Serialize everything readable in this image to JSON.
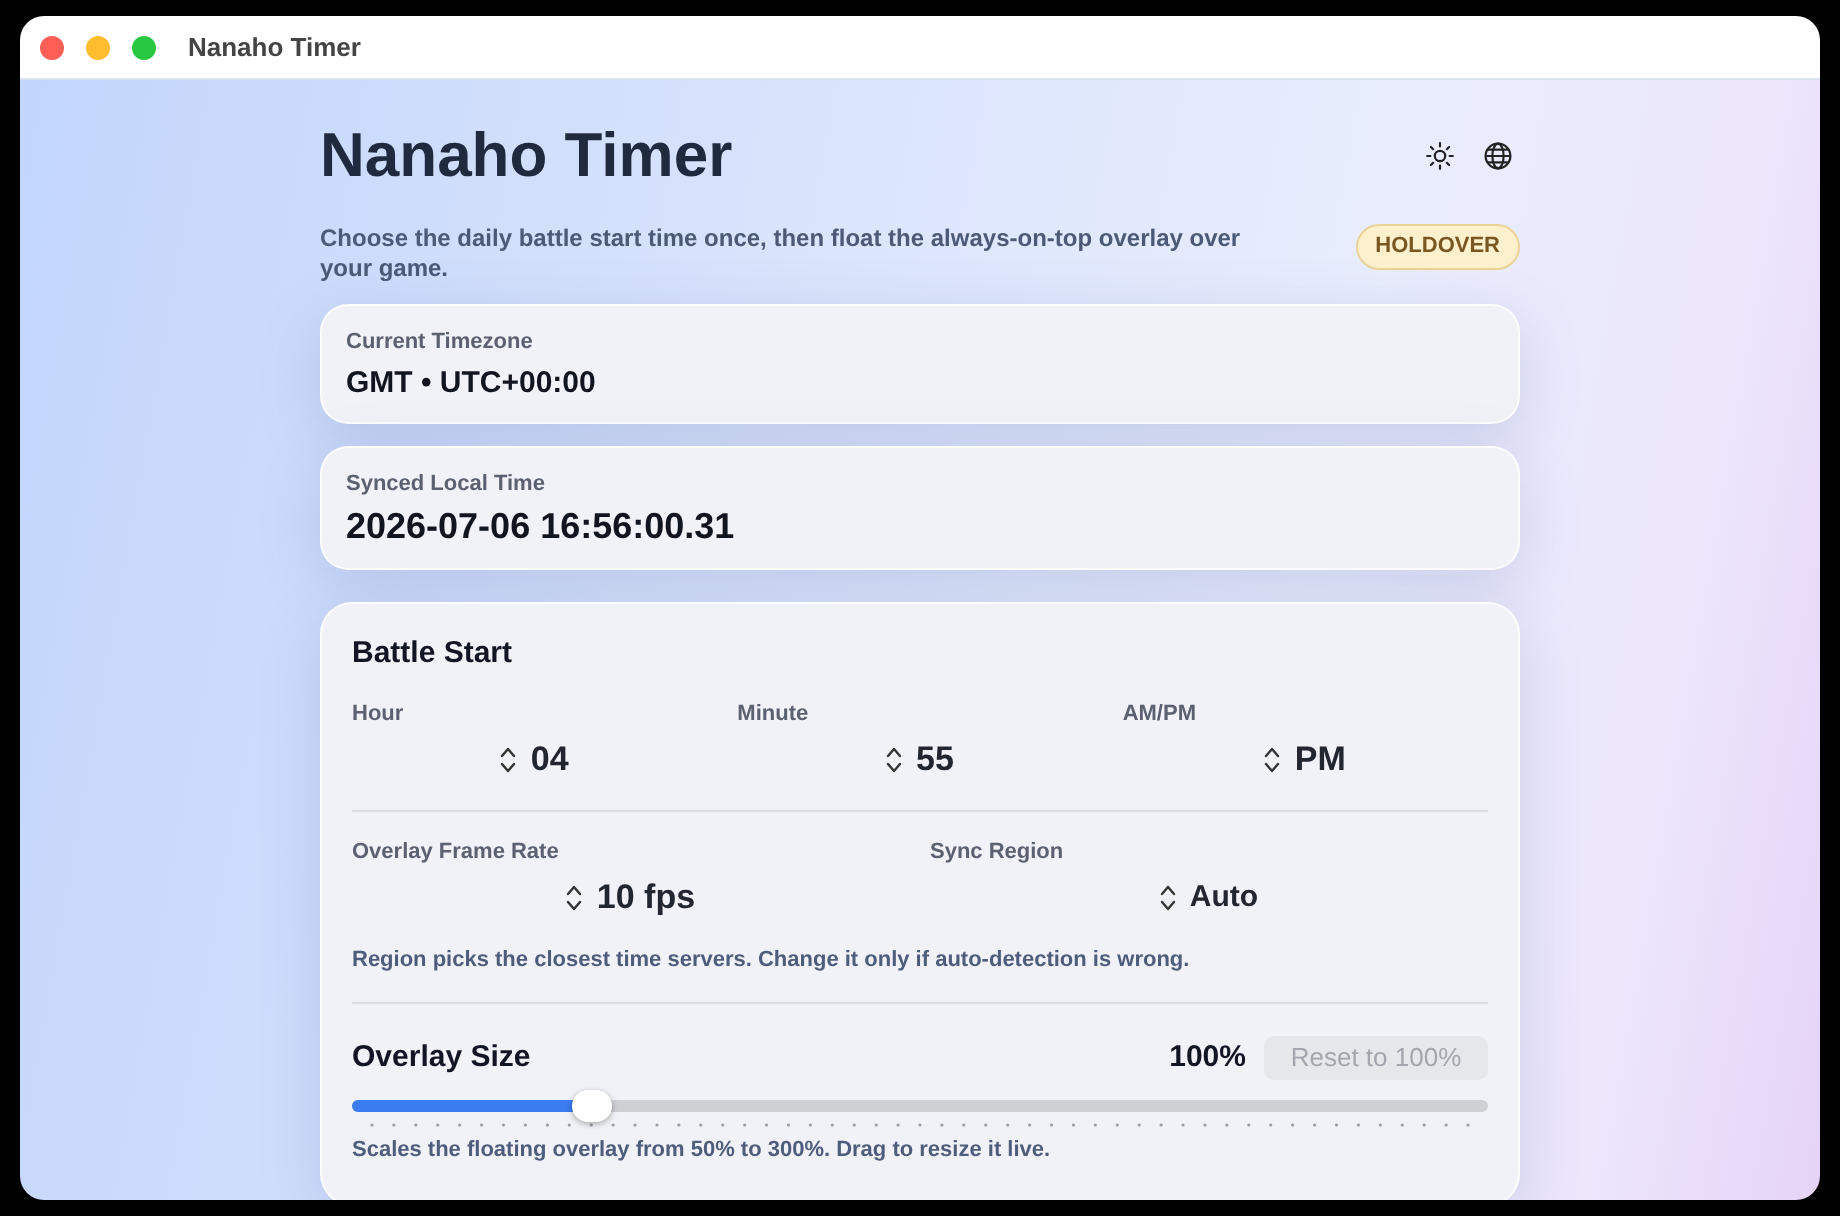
{
  "window": {
    "title": "Nanaho Timer"
  },
  "header": {
    "title": "Nanaho Timer",
    "subtitle": "Choose the daily battle start time once, then float the always-on-top overlay over your game.",
    "badge": "HOLDOVER"
  },
  "info_cards": [
    {
      "label": "Current Timezone",
      "value": "GMT • UTC+00:00"
    },
    {
      "label": "Synced Local Time",
      "value": "2026-07-06 16:56:00.31"
    }
  ],
  "battle_start": {
    "title": "Battle Start",
    "time_fields": [
      {
        "label": "Hour",
        "value": "04"
      },
      {
        "label": "Minute",
        "value": "55"
      },
      {
        "label": "AM/PM",
        "value": "PM"
      }
    ],
    "settings": [
      {
        "label": "Overlay Frame Rate",
        "value": "10 fps"
      },
      {
        "label": "Sync Region",
        "value": "Auto"
      }
    ],
    "settings_note": "Region picks the closest time servers. Change it only if auto-detection is wrong.",
    "overlay_size": {
      "title": "Overlay Size",
      "reading": "100%",
      "reset_button": {
        "label": "Reset to 100%",
        "disabled": true
      },
      "level": 0.2,
      "note": "Scales the floating overlay from 50% to 300%. Drag to resize it live."
    }
  }
}
